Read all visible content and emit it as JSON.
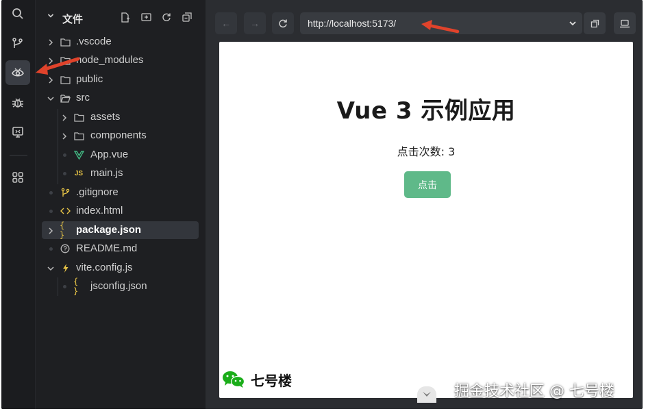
{
  "explorer": {
    "title": "文件",
    "tools": [
      "new-file-icon",
      "new-folder-icon",
      "refresh-icon",
      "collapse-all-icon"
    ],
    "items": [
      {
        "label": ".vscode",
        "type": "folder",
        "expanded": false
      },
      {
        "label": "node_modules",
        "type": "folder",
        "expanded": false
      },
      {
        "label": "public",
        "type": "folder",
        "expanded": false
      },
      {
        "label": "src",
        "type": "folder",
        "expanded": true
      },
      {
        "label": "assets",
        "type": "folder",
        "expanded": false
      },
      {
        "label": "components",
        "type": "folder",
        "expanded": false
      },
      {
        "label": "App.vue",
        "type": "vue-file"
      },
      {
        "label": "main.js",
        "type": "js-file",
        "icon_text": "JS"
      },
      {
        "label": ".gitignore",
        "type": "git-file"
      },
      {
        "label": "index.html",
        "type": "html-file"
      },
      {
        "label": "package.json",
        "type": "json-file",
        "selected": true
      },
      {
        "label": "README.md",
        "type": "info-file"
      },
      {
        "label": "vite.config.js",
        "type": "vite-file",
        "expanded": true
      },
      {
        "label": "jsconfig.json",
        "type": "json-file"
      }
    ]
  },
  "activity_bar": [
    "search-icon",
    "source-control-icon",
    "preview-icon",
    "debug-icon",
    "remote-icon",
    "extensions-icon"
  ],
  "browser": {
    "url": "http://localhost:5173/",
    "back_icon": "←",
    "forward_icon": "→"
  },
  "app": {
    "title": "Vue 3 示例应用",
    "count_text": "点击次数: 3",
    "button_label": "点击"
  },
  "overlay": {
    "wechat_name": "七号楼",
    "watermark": "掘金技术社区 @ 七号楼"
  },
  "colors": {
    "accent_green": "#5fb989",
    "vue_green": "#42b883",
    "js_yellow": "#e8c547",
    "arrow_red": "#e0432b"
  }
}
